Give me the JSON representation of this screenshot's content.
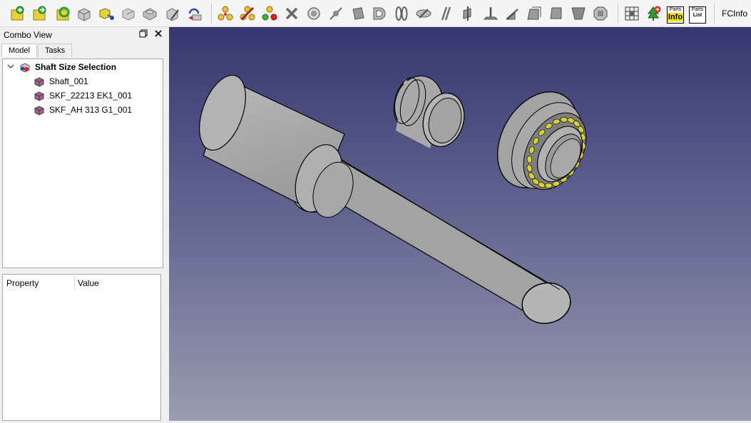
{
  "toolbar": {
    "icons": [
      "create-part-icon",
      "add-part-icon",
      "refresh-icon",
      "part-icon",
      "move-icon",
      "shape-icon",
      "solid-icon",
      "edit-icon",
      "import-icon",
      "constraint-1-icon",
      "constraint-2-icon",
      "constraint-3-icon",
      "delete-constraint-icon",
      "circle-icon",
      "line-icon",
      "box-icon",
      "half-shell-icon",
      "double-ring-icon",
      "disk-icon",
      "parallel-icon",
      "plane-icon",
      "axis-icon",
      "angle-icon",
      "face-icon",
      "square-icon",
      "trapezoid-icon",
      "octagon-icon",
      "grid-icon",
      "tree-add-icon"
    ],
    "parts_info": {
      "top": "Parts",
      "big": "Info"
    },
    "parts_list": {
      "top": "Parts",
      "big": "List"
    },
    "fcinfo_label": "FCInfo"
  },
  "combo_view": {
    "title": "Combo View",
    "tabs": [
      "Model",
      "Tasks"
    ],
    "active_tab": "Model",
    "tree": {
      "root": "Shaft Size Selection",
      "children": [
        "Shaft_001",
        "SKF_22213 EK1_001",
        "SKF_AH 313 G1_001"
      ]
    },
    "properties": {
      "col_property": "Property",
      "col_value": "Value"
    }
  },
  "colors": {
    "viewport_top": "#373770",
    "viewport_bottom": "#9b9bb0",
    "part_gray": "#a9a9a9",
    "roller_yellow": "#d6d030"
  }
}
